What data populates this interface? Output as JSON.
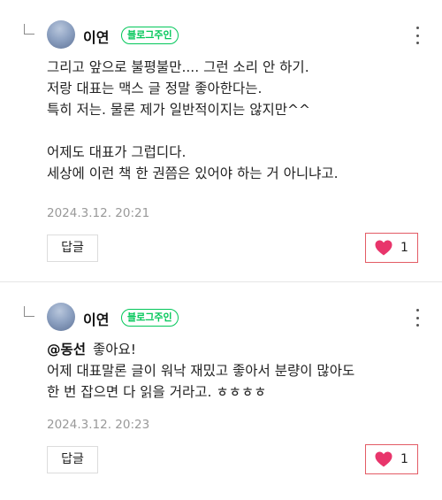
{
  "comments": [
    {
      "author": "이연",
      "badge": "블로그주인",
      "lines": [
        "그리고 앞으로 불평불만.... 그런 소리 안 하기.",
        "저랑 대표는 맥스 글 정말 좋아한다는.",
        "특히 저는. 물론 제가 일반적이지는 않지만^^",
        "",
        "어제도 대표가 그럽디다.",
        "세상에 이런 책 한 권쯤은 있어야 하는 거 아니냐고."
      ],
      "timestamp": "2024.3.12. 20:21",
      "reply_label": "답글",
      "like_count": "1"
    },
    {
      "author": "이연",
      "badge": "블로그주인",
      "mention": "@동선",
      "first_line": "좋아요!",
      "lines": [
        "어제 대표말론 글이 워낙 재밌고 좋아서 분량이 많아도",
        "한 번 잡으면 다 읽을 거라고. ㅎㅎㅎㅎ"
      ],
      "timestamp": "2024.3.12. 20:23",
      "reply_label": "답글",
      "like_count": "1"
    }
  ],
  "colors": {
    "badge_green": "#03c75a",
    "like_red": "#e35b65",
    "heart_pink": "#e8356b"
  },
  "icons": {
    "reply": "reply-arrow-icon",
    "more": "more-vertical-icon",
    "like": "heart-icon"
  }
}
